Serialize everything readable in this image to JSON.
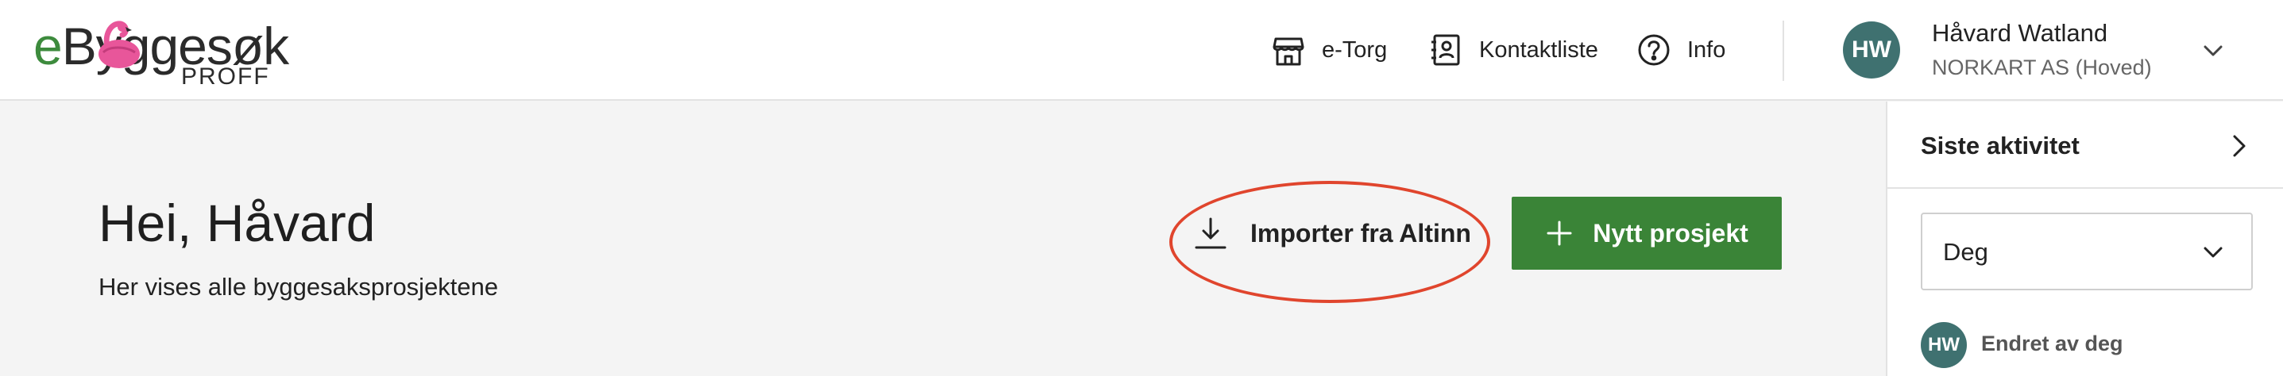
{
  "header": {
    "logo_main_rest": "Byggesøk",
    "logo_e": "e",
    "logo_sub": "PROFF",
    "nav": [
      {
        "label": "e-Torg",
        "icon": "store-icon"
      },
      {
        "label": "Kontaktliste",
        "icon": "contact-book-icon"
      },
      {
        "label": "Info",
        "icon": "help-circle-icon"
      }
    ],
    "user": {
      "initials": "HW",
      "name": "Håvard Watland",
      "org": "NORKART AS (Hoved)"
    }
  },
  "main": {
    "title": "Hei, Håvard",
    "subtitle": "Her vises alle byggesaksprosjektene",
    "import_label": "Importer fra Altinn",
    "new_project_label": "Nytt prosjekt"
  },
  "side_panel": {
    "heading": "Siste aktivitet",
    "filter_value": "Deg",
    "activity": {
      "initials": "HW",
      "text": "Endret av deg"
    }
  },
  "colors": {
    "brand_green": "#3a8437",
    "avatar_teal": "#3f7170",
    "highlight_red": "#e0452d",
    "logo_pink": "#e8569a"
  }
}
